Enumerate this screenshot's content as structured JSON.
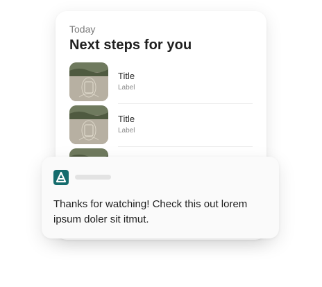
{
  "card": {
    "eyebrow": "Today",
    "headline": "Next steps for you",
    "items": [
      {
        "title": "Title",
        "label": "Label",
        "thumbnail_icon": "photo-thumbnail"
      },
      {
        "title": "Title",
        "label": "Label",
        "thumbnail_icon": "photo-thumbnail"
      },
      {
        "title": "",
        "label": "",
        "thumbnail_icon": "photo-thumbnail"
      }
    ]
  },
  "notification": {
    "app_icon": "app-logo-icon",
    "app_icon_color": "#156c6d",
    "message": "Thanks for watching! Check this out lorem ipsum doler sit itmut."
  }
}
